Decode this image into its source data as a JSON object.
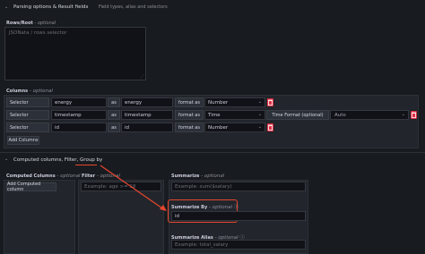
{
  "parsing": {
    "title": "Parsing options & Result fields",
    "subtitle": "Field types, alias and selectors",
    "rows_root_label": "Rows/Root",
    "optional": "optional",
    "rows_root_placeholder": "JSONata / rows selector"
  },
  "columns": {
    "label": "Columns",
    "optional": "optional",
    "rows": [
      {
        "selector_label": "Selector",
        "selector": "energy",
        "as_label": "as",
        "alias": "energy",
        "format_label": "format as",
        "format": "Number"
      },
      {
        "selector_label": "Selector",
        "selector": "timestamp",
        "as_label": "as",
        "alias": "timestamp",
        "format_label": "format as",
        "format": "Time",
        "time_format_label": "Time Format (optional)",
        "time_format": "Auto"
      },
      {
        "selector_label": "Selector",
        "selector": "id",
        "as_label": "as",
        "alias": "id",
        "format_label": "format as",
        "format": "Number"
      }
    ],
    "add_button": "Add Columns"
  },
  "computed": {
    "title": "Computed columns, Filter, Group by",
    "computed_label": "Computed Columns",
    "optional": "optional",
    "add_button": "Add Computed column",
    "filter_label": "Filter",
    "filter_placeholder": "Example: age >= 18",
    "summarize_label": "Summarize",
    "summarize_placeholder": "Example: sum($salary)",
    "summarize_by_label": "Summarize By",
    "summarize_by_value": "id",
    "summarize_alias_label": "Summarize Alias",
    "summarize_alias_placeholder": "Example: total_salary"
  },
  "colors": {
    "highlight": "#e8472e",
    "delete": "#e02f44"
  }
}
